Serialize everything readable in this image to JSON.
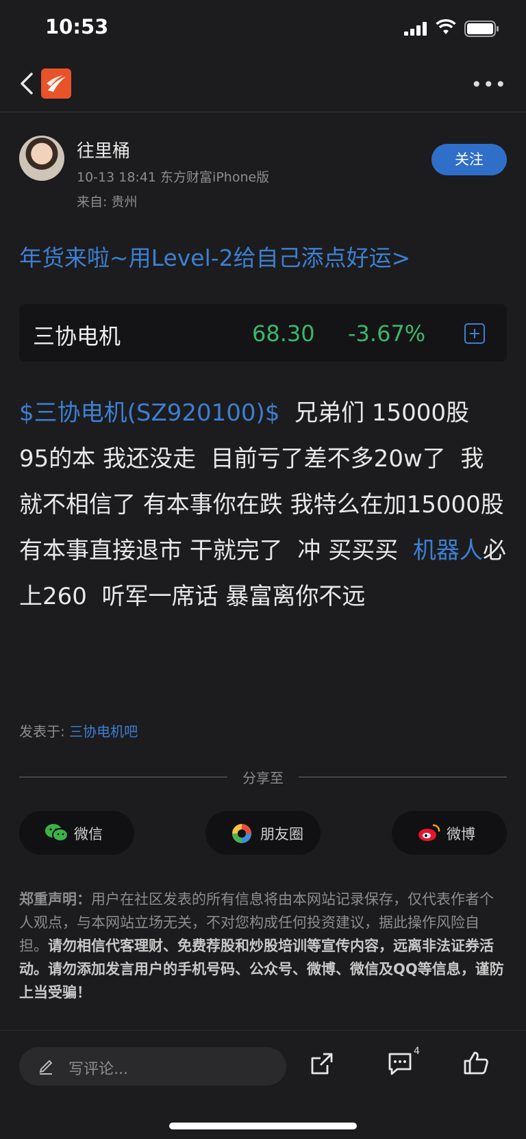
{
  "status_bar": {
    "time": "10:53"
  },
  "nav": {
    "more_label": "•••"
  },
  "author": {
    "name": "往里桶",
    "meta": "10-13 18:41 东方财富iPhone版",
    "location": "来自: 贵州",
    "follow_label": "关注"
  },
  "promo": {
    "text": "年货来啦~用Level-2给自己添点好运>"
  },
  "stock": {
    "name": "三协电机",
    "price": "68.30",
    "change": "-3.67%"
  },
  "post": {
    "tag": "$三协电机(SZ920100)$",
    "text1": "  兄弟们 15000股  95的本 我还没走  目前亏了差不多20w了  我就不相信了 有本事你在跌 我特么在加15000股     有本事直接退市 干就完了  冲 买买买  ",
    "link": "机器人",
    "text2": "必上260  听军一席话 暴富离你不远"
  },
  "posted_in": {
    "label": "发表于: ",
    "forum": "三协电机吧"
  },
  "share": {
    "title": "分享至",
    "wechat": "微信",
    "moments": "朋友圈",
    "weibo": "微博"
  },
  "disclaimer": {
    "head": "郑重声明：",
    "normal": "用户在社区发表的所有信息将由本网站记录保存，仅代表作者个人观点，与本网站立场无关，不对您构成任何投资建议，据此操作风险自担。",
    "strong": "请勿相信代客理财、免费荐股和炒股培训等宣传内容，远离非法证券活动。请勿添加发言用户的手机号码、公众号、微博、微信及QQ等信息，谨防上当受骗！"
  },
  "bottom_bar": {
    "comment_placeholder": "写评论...",
    "comment_count": "4"
  },
  "colors": {
    "accent": "#2f6fca",
    "link": "#3d7fd1",
    "down": "#3bb86a",
    "background": "#1c1c1e"
  }
}
